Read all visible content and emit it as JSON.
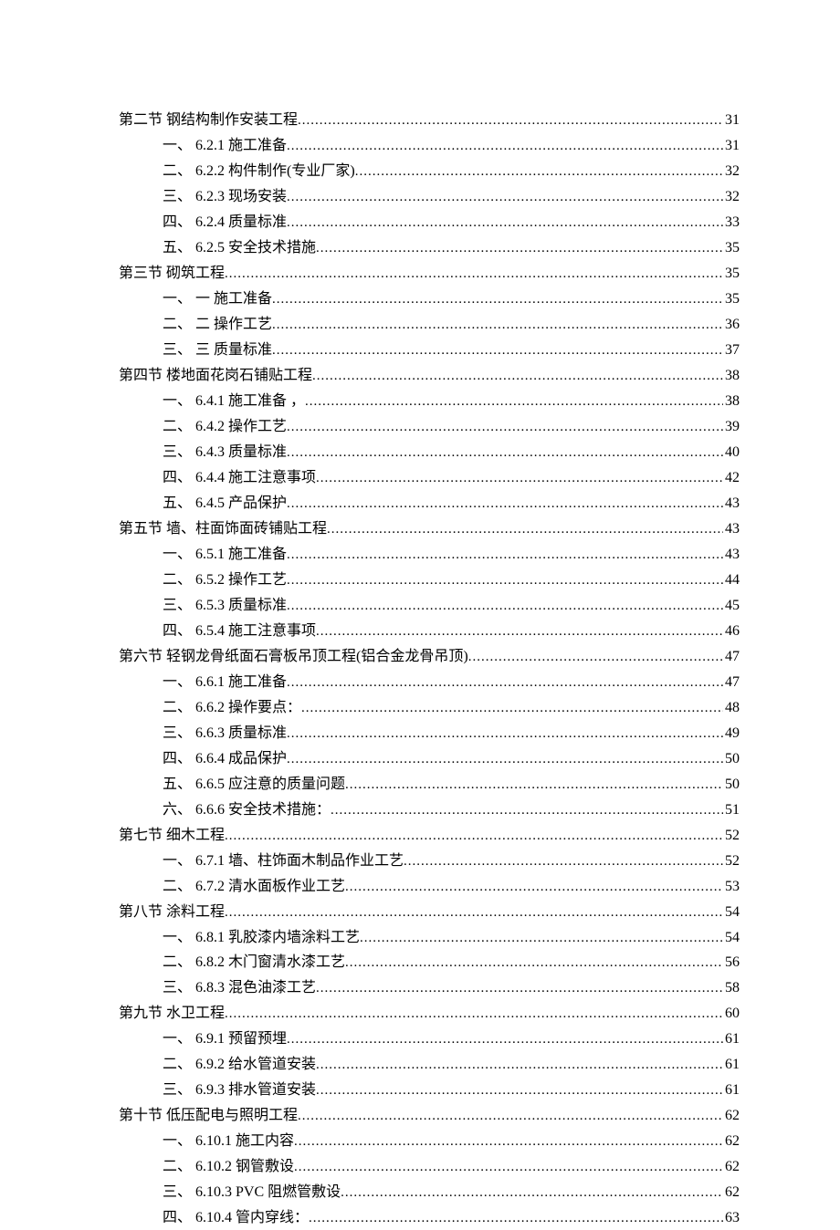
{
  "toc": [
    {
      "level": 1,
      "prefix": "第二节",
      "title": " 钢结构制作安装工程",
      "page": "31"
    },
    {
      "level": 2,
      "prefix": "一、",
      "title": " 6.2.1 施工准备",
      "page": "31"
    },
    {
      "level": 2,
      "prefix": "二、",
      "title": " 6.2.2 构件制作(专业厂家)",
      "page": "32"
    },
    {
      "level": 2,
      "prefix": "三、",
      "title": " 6.2.3  现场安装",
      "page": "32"
    },
    {
      "level": 2,
      "prefix": "四、",
      "title": " 6.2.4 质量标准",
      "page": "33"
    },
    {
      "level": 2,
      "prefix": "五、",
      "title": " 6.2.5  安全技术措施",
      "page": "35"
    },
    {
      "level": 1,
      "prefix": "第三节",
      "title": " 砌筑工程",
      "page": "35"
    },
    {
      "level": 2,
      "prefix": "一、",
      "title": " 一 施工准备",
      "page": "35"
    },
    {
      "level": 2,
      "prefix": "二、",
      "title": " 二 操作工艺",
      "page": "36"
    },
    {
      "level": 2,
      "prefix": "三、",
      "title": " 三 质量标准",
      "page": "37"
    },
    {
      "level": 1,
      "prefix": "第四节",
      "title": " 楼地面花岗石铺贴工程",
      "page": "38"
    },
    {
      "level": 2,
      "prefix": "一、",
      "title": " 6.4.1 施工准备   ，",
      "page": "38"
    },
    {
      "level": 2,
      "prefix": "二、",
      "title": " 6.4.2 操作工艺",
      "page": "39"
    },
    {
      "level": 2,
      "prefix": "三、",
      "title": " 6.4.3 质量标准",
      "page": "40"
    },
    {
      "level": 2,
      "prefix": "四、",
      "title": " 6.4.4 施工注意事项",
      "page": "42"
    },
    {
      "level": 2,
      "prefix": "五、",
      "title": " 6.4.5 产品保护",
      "page": "43"
    },
    {
      "level": 1,
      "prefix": "第五节",
      "title": " 墙、柱面饰面砖铺贴工程",
      "page": "43"
    },
    {
      "level": 2,
      "prefix": "一、",
      "title": " 6.5.1 施工准备",
      "page": "43"
    },
    {
      "level": 2,
      "prefix": "二、",
      "title": " 6.5.2 操作工艺",
      "page": "44"
    },
    {
      "level": 2,
      "prefix": "三、",
      "title": " 6.5.3 质量标准",
      "page": "45"
    },
    {
      "level": 2,
      "prefix": "四、",
      "title": " 6.5.4 施工注意事项",
      "page": "46"
    },
    {
      "level": 1,
      "prefix": "第六节",
      "title": " 轻钢龙骨纸面石膏板吊顶工程(铝合金龙骨吊顶)",
      "page": "47"
    },
    {
      "level": 2,
      "prefix": "一、",
      "title": " 6.6.1 施工准备",
      "page": "47"
    },
    {
      "level": 2,
      "prefix": "二、",
      "title": " 6.6.2 操作要点：",
      "page": "48"
    },
    {
      "level": 2,
      "prefix": "三、",
      "title": " 6.6.3 质量标准",
      "page": "49"
    },
    {
      "level": 2,
      "prefix": "四、",
      "title": " 6.6.4 成品保护",
      "page": "50"
    },
    {
      "level": 2,
      "prefix": "五、",
      "title": " 6.6.5 应注意的质量问题",
      "page": "50"
    },
    {
      "level": 2,
      "prefix": "六、",
      "title": " 6.6.6 安全技术措施：",
      "page": "51"
    },
    {
      "level": 1,
      "prefix": "第七节",
      "title": " 细木工程",
      "page": "52"
    },
    {
      "level": 2,
      "prefix": "一、",
      "title": " 6.7.1 墙、柱饰面木制品作业工艺",
      "page": "52"
    },
    {
      "level": 2,
      "prefix": "二、",
      "title": " 6.7.2 清水面板作业工艺",
      "page": "53"
    },
    {
      "level": 1,
      "prefix": "第八节",
      "title": " 涂料工程",
      "page": "54"
    },
    {
      "level": 2,
      "prefix": "一、",
      "title": " 6.8.1 乳胶漆内墙涂料工艺",
      "page": "54"
    },
    {
      "level": 2,
      "prefix": "二、",
      "title": " 6.8.2 木门窗清水漆工艺",
      "page": "56"
    },
    {
      "level": 2,
      "prefix": "三、",
      "title": " 6.8.3  混色油漆工艺",
      "page": "58"
    },
    {
      "level": 1,
      "prefix": "第九节",
      "title": " 水卫工程",
      "page": "60"
    },
    {
      "level": 2,
      "prefix": "一、",
      "title": " 6.9.1 预留预埋",
      "page": "61"
    },
    {
      "level": 2,
      "prefix": "二、",
      "title": " 6.9.2 给水管道安装",
      "page": "61"
    },
    {
      "level": 2,
      "prefix": "三、",
      "title": " 6.9.3 排水管道安装",
      "page": "61"
    },
    {
      "level": 1,
      "prefix": "第十节",
      "title": " 低压配电与照明工程",
      "page": "62"
    },
    {
      "level": 2,
      "prefix": "一、",
      "title": " 6.10.1 施工内容",
      "page": "62"
    },
    {
      "level": 2,
      "prefix": "二、",
      "title": " 6.10.2 钢管敷设",
      "page": "62"
    },
    {
      "level": 2,
      "prefix": "三、",
      "title": " 6.10.3 PVC 阻燃管敷设",
      "page": "62"
    },
    {
      "level": 2,
      "prefix": "四、",
      "title": " 6.10.4 管内穿线：",
      "page": "63"
    }
  ]
}
